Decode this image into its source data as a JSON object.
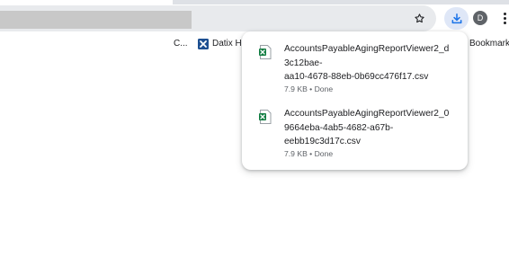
{
  "toolbar": {
    "bookmark_star_icon": "star-outline-icon",
    "download_icon": "download-icon",
    "profile_initial": "D",
    "menu_icon": "vertical-dots-icon",
    "accent_color": "#1a73e8"
  },
  "bookmarks": {
    "items": [
      {
        "label": "C..."
      },
      {
        "label": "Datix Ho",
        "icon": "datix-icon"
      },
      {
        "label": "Bookmarks"
      }
    ]
  },
  "downloads": {
    "items": [
      {
        "filename_lines": [
          "AccountsPayableAgingReportViewer2_d",
          "3c12bae-",
          "aa10-4678-88eb-0b69cc476f17.csv"
        ],
        "status": "7.9 KB • Done",
        "icon": "excel-file-icon"
      },
      {
        "filename_lines": [
          "AccountsPayableAgingReportViewer2_0",
          "9664eba-4ab5-4682-a67b-",
          "eebb19c3d17c.csv"
        ],
        "status": "7.9 KB • Done",
        "icon": "excel-file-icon"
      }
    ]
  }
}
